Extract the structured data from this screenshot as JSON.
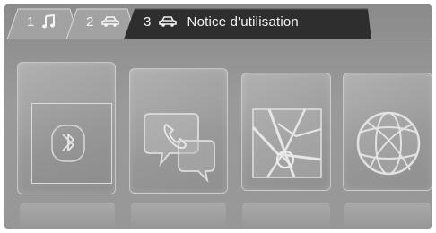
{
  "tabs": [
    {
      "number": "1",
      "icon": "music-note-icon"
    },
    {
      "number": "2",
      "icon": "car-icon"
    },
    {
      "number": "3",
      "icon": "car-icon",
      "label": "Notice d'utilisation"
    }
  ],
  "apps": [
    {
      "icon": "bluetooth-icon"
    },
    {
      "icon": "phone-call-icon"
    },
    {
      "icon": "navigation-map-icon"
    },
    {
      "icon": "globe-icon"
    }
  ],
  "colors": {
    "background": "#939393",
    "active_tab": "#2e2e2e",
    "tab_text": "#f4f4f4",
    "tile_border": "#d7d7d7"
  }
}
